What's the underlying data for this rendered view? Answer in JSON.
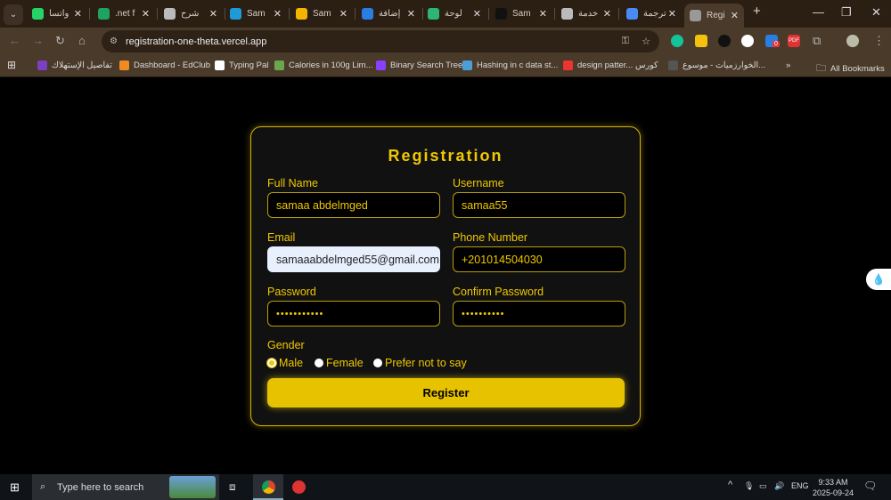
{
  "browser": {
    "tabs": [
      {
        "label": "واتسا",
        "icon": "whatsapp-icon",
        "color": "#25d366"
      },
      {
        "label": ".net f",
        "icon": "sheets-icon",
        "color": "#1ea362"
      },
      {
        "label": "شرح",
        "icon": "chatgpt-icon",
        "color": "#bbbbbb"
      },
      {
        "label": "Sam",
        "icon": "circle-app-icon",
        "color": "#1e9bd7"
      },
      {
        "label": "Sam",
        "icon": "blogger-icon",
        "color": "#f4b400"
      },
      {
        "label": "إضافة",
        "icon": "app-icon",
        "color": "#2a7de1"
      },
      {
        "label": "لوحة",
        "icon": "k-icon",
        "color": "#2bb673"
      },
      {
        "label": "Sam",
        "icon": "upwork-icon",
        "color": "#111111"
      },
      {
        "label": "خدمة",
        "icon": "chatgpt-icon",
        "color": "#bbbbbb"
      },
      {
        "label": "ترجمة",
        "icon": "translate-icon",
        "color": "#4a8af4"
      },
      {
        "label": "Regi",
        "icon": "globe-icon",
        "color": "#999999",
        "active": true
      }
    ],
    "url": "registration-one-theta.vercel.app",
    "bookmarks": [
      "تفاصيل الإستهلاك",
      "Dashboard - EdClub",
      "Typing Pal",
      "Calories in 100g Lim...",
      "Binary Search Tree",
      "Hashing in c data st...",
      "design patter... كورس",
      "الخوارزميات - موسوع...",
      "All Bookmarks"
    ],
    "extension_badge": "0"
  },
  "form": {
    "title": "Registration",
    "fields": [
      {
        "label": "Full Name",
        "value": "samaa abdelmged"
      },
      {
        "label": "Username",
        "value": "samaa55"
      },
      {
        "label": "Email",
        "value": "samaaabdelmged55@gmail.com"
      },
      {
        "label": "Phone Number",
        "value": "+201014504030"
      },
      {
        "label": "Password",
        "value": "•••••••••••"
      },
      {
        "label": "Confirm Password",
        "value": "••••••••••"
      }
    ],
    "gender_label": "Gender",
    "gender_options": [
      "Male",
      "Female",
      "Prefer not to say"
    ],
    "gender_selected": "Male",
    "submit": "Register",
    "accent": "#f0c800"
  },
  "taskbar": {
    "search_placeholder": "Type here to search",
    "lang": "ENG",
    "time": "9:33 AM",
    "date": "2025-09-24"
  }
}
